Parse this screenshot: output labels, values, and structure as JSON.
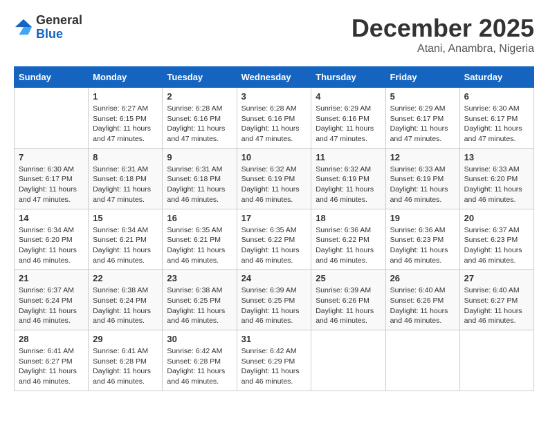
{
  "logo": {
    "general": "General",
    "blue": "Blue"
  },
  "title": "December 2025",
  "location": "Atani, Anambra, Nigeria",
  "days_of_week": [
    "Sunday",
    "Monday",
    "Tuesday",
    "Wednesday",
    "Thursday",
    "Friday",
    "Saturday"
  ],
  "weeks": [
    [
      {
        "day": "",
        "info": ""
      },
      {
        "day": "1",
        "info": "Sunrise: 6:27 AM\nSunset: 6:15 PM\nDaylight: 11 hours and 47 minutes."
      },
      {
        "day": "2",
        "info": "Sunrise: 6:28 AM\nSunset: 6:16 PM\nDaylight: 11 hours and 47 minutes."
      },
      {
        "day": "3",
        "info": "Sunrise: 6:28 AM\nSunset: 6:16 PM\nDaylight: 11 hours and 47 minutes."
      },
      {
        "day": "4",
        "info": "Sunrise: 6:29 AM\nSunset: 6:16 PM\nDaylight: 11 hours and 47 minutes."
      },
      {
        "day": "5",
        "info": "Sunrise: 6:29 AM\nSunset: 6:17 PM\nDaylight: 11 hours and 47 minutes."
      },
      {
        "day": "6",
        "info": "Sunrise: 6:30 AM\nSunset: 6:17 PM\nDaylight: 11 hours and 47 minutes."
      }
    ],
    [
      {
        "day": "7",
        "info": "Sunrise: 6:30 AM\nSunset: 6:17 PM\nDaylight: 11 hours and 47 minutes."
      },
      {
        "day": "8",
        "info": "Sunrise: 6:31 AM\nSunset: 6:18 PM\nDaylight: 11 hours and 47 minutes."
      },
      {
        "day": "9",
        "info": "Sunrise: 6:31 AM\nSunset: 6:18 PM\nDaylight: 11 hours and 46 minutes."
      },
      {
        "day": "10",
        "info": "Sunrise: 6:32 AM\nSunset: 6:19 PM\nDaylight: 11 hours and 46 minutes."
      },
      {
        "day": "11",
        "info": "Sunrise: 6:32 AM\nSunset: 6:19 PM\nDaylight: 11 hours and 46 minutes."
      },
      {
        "day": "12",
        "info": "Sunrise: 6:33 AM\nSunset: 6:19 PM\nDaylight: 11 hours and 46 minutes."
      },
      {
        "day": "13",
        "info": "Sunrise: 6:33 AM\nSunset: 6:20 PM\nDaylight: 11 hours and 46 minutes."
      }
    ],
    [
      {
        "day": "14",
        "info": "Sunrise: 6:34 AM\nSunset: 6:20 PM\nDaylight: 11 hours and 46 minutes."
      },
      {
        "day": "15",
        "info": "Sunrise: 6:34 AM\nSunset: 6:21 PM\nDaylight: 11 hours and 46 minutes."
      },
      {
        "day": "16",
        "info": "Sunrise: 6:35 AM\nSunset: 6:21 PM\nDaylight: 11 hours and 46 minutes."
      },
      {
        "day": "17",
        "info": "Sunrise: 6:35 AM\nSunset: 6:22 PM\nDaylight: 11 hours and 46 minutes."
      },
      {
        "day": "18",
        "info": "Sunrise: 6:36 AM\nSunset: 6:22 PM\nDaylight: 11 hours and 46 minutes."
      },
      {
        "day": "19",
        "info": "Sunrise: 6:36 AM\nSunset: 6:23 PM\nDaylight: 11 hours and 46 minutes."
      },
      {
        "day": "20",
        "info": "Sunrise: 6:37 AM\nSunset: 6:23 PM\nDaylight: 11 hours and 46 minutes."
      }
    ],
    [
      {
        "day": "21",
        "info": "Sunrise: 6:37 AM\nSunset: 6:24 PM\nDaylight: 11 hours and 46 minutes."
      },
      {
        "day": "22",
        "info": "Sunrise: 6:38 AM\nSunset: 6:24 PM\nDaylight: 11 hours and 46 minutes."
      },
      {
        "day": "23",
        "info": "Sunrise: 6:38 AM\nSunset: 6:25 PM\nDaylight: 11 hours and 46 minutes."
      },
      {
        "day": "24",
        "info": "Sunrise: 6:39 AM\nSunset: 6:25 PM\nDaylight: 11 hours and 46 minutes."
      },
      {
        "day": "25",
        "info": "Sunrise: 6:39 AM\nSunset: 6:26 PM\nDaylight: 11 hours and 46 minutes."
      },
      {
        "day": "26",
        "info": "Sunrise: 6:40 AM\nSunset: 6:26 PM\nDaylight: 11 hours and 46 minutes."
      },
      {
        "day": "27",
        "info": "Sunrise: 6:40 AM\nSunset: 6:27 PM\nDaylight: 11 hours and 46 minutes."
      }
    ],
    [
      {
        "day": "28",
        "info": "Sunrise: 6:41 AM\nSunset: 6:27 PM\nDaylight: 11 hours and 46 minutes."
      },
      {
        "day": "29",
        "info": "Sunrise: 6:41 AM\nSunset: 6:28 PM\nDaylight: 11 hours and 46 minutes."
      },
      {
        "day": "30",
        "info": "Sunrise: 6:42 AM\nSunset: 6:28 PM\nDaylight: 11 hours and 46 minutes."
      },
      {
        "day": "31",
        "info": "Sunrise: 6:42 AM\nSunset: 6:29 PM\nDaylight: 11 hours and 46 minutes."
      },
      {
        "day": "",
        "info": ""
      },
      {
        "day": "",
        "info": ""
      },
      {
        "day": "",
        "info": ""
      }
    ]
  ]
}
